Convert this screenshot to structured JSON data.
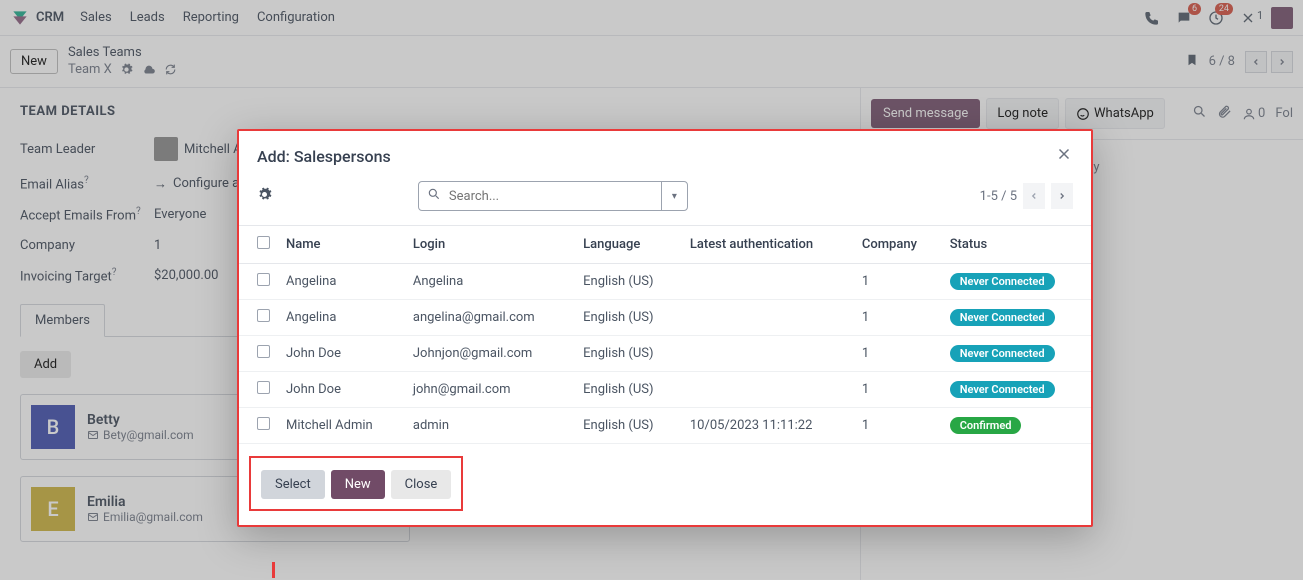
{
  "topbar": {
    "app": "CRM",
    "menus": [
      "Sales",
      "Leads",
      "Reporting",
      "Configuration"
    ],
    "badges": {
      "chat": "6",
      "activity": "24",
      "warn": "1"
    }
  },
  "subbar": {
    "new": "New",
    "bc_line1": "Sales Teams",
    "bc_line2": "Team X",
    "pager": "6 / 8"
  },
  "form": {
    "heading": "TEAM DETAILS",
    "rows": {
      "team_leader_label": "Team Leader",
      "team_leader_value": "Mitchell Admin",
      "email_alias_label": "Email Alias",
      "email_alias_value": "Configure a custom domain",
      "accept_label": "Accept Emails From",
      "accept_value": "Everyone",
      "company_label": "Company",
      "company_value": "1",
      "target_label": "Invoicing Target",
      "target_value": "$20,000.00"
    },
    "tab_members": "Members",
    "add": "Add",
    "members": [
      {
        "initial": "B",
        "color": "#3949ab",
        "name": "Betty",
        "email": "Bety@gmail.com"
      },
      {
        "initial": "E",
        "color": "#c9b037",
        "name": "Emilia",
        "email": "Emilia@gmail.com"
      }
    ]
  },
  "chatter": {
    "send": "Send message",
    "log": "Log note",
    "whatsapp": "WhatsApp",
    "attach_count": "0",
    "follow": "Fol",
    "today": "Today"
  },
  "modal": {
    "title": "Add: Salespersons",
    "search_placeholder": "Search...",
    "pager": "1-5 / 5",
    "headers": {
      "name": "Name",
      "login": "Login",
      "language": "Language",
      "latest": "Latest authentication",
      "company": "Company",
      "status": "Status"
    },
    "rows": [
      {
        "name": "Angelina",
        "login": "Angelina",
        "lang": "English (US)",
        "latest": "",
        "company": "1",
        "status": "Never Connected",
        "status_class": "never"
      },
      {
        "name": "Angelina",
        "login": "angelina@gmail.com",
        "lang": "English (US)",
        "latest": "",
        "company": "1",
        "status": "Never Connected",
        "status_class": "never"
      },
      {
        "name": "John Doe",
        "login": "Johnjon@gmail.com",
        "lang": "English (US)",
        "latest": "",
        "company": "1",
        "status": "Never Connected",
        "status_class": "never"
      },
      {
        "name": "John Doe",
        "login": "john@gmail.com",
        "lang": "English (US)",
        "latest": "",
        "company": "1",
        "status": "Never Connected",
        "status_class": "never"
      },
      {
        "name": "Mitchell Admin",
        "login": "admin",
        "lang": "English (US)",
        "latest": "10/05/2023 11:11:22",
        "company": "1",
        "status": "Confirmed",
        "status_class": "confirmed"
      }
    ],
    "buttons": {
      "select": "Select",
      "new": "New",
      "close": "Close"
    }
  }
}
